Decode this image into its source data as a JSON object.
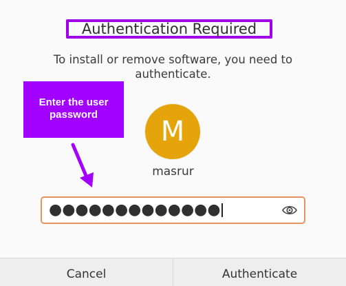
{
  "dialog": {
    "title": "Authentication Required",
    "subtitle": "To install or remove software, you need to authenticate.",
    "user": {
      "initial": "M",
      "name": "masrur",
      "avatar_color": "#e5a50a"
    },
    "password": {
      "masked_value": "●●●●●●●●●●●●●",
      "reveal_icon": "eye-icon"
    },
    "buttons": {
      "cancel": "Cancel",
      "authenticate": "Authenticate"
    }
  },
  "annotation": {
    "callout_text": "Enter the user password",
    "highlight_color": "#a200ff",
    "arrow_icon": "arrow-down-icon"
  },
  "colors": {
    "focus_border": "#e8935f",
    "background": "#fafafa"
  }
}
